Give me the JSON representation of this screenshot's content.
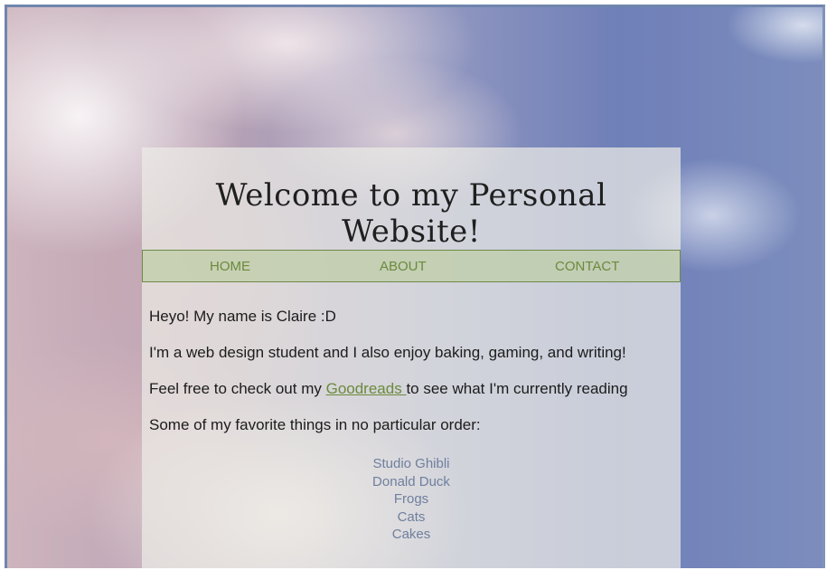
{
  "header": {
    "title": "Welcome to my Personal Website!"
  },
  "nav": {
    "items": [
      {
        "label": "HOME"
      },
      {
        "label": "ABOUT"
      },
      {
        "label": "CONTACT"
      }
    ]
  },
  "main": {
    "intro": "Heyo! My name is Claire :D",
    "about": "I'm a web design student and I also enjoy baking, gaming, and writing!",
    "goodreads_before": "Feel free to check out my ",
    "goodreads_link": "Goodreads ",
    "goodreads_after": "to see what I'm currently reading",
    "favorites_heading": "Some of my favorite things in no particular order:",
    "favorites": [
      "Studio Ghibli",
      "Donald Duck",
      "Frogs",
      "Cats",
      "Cakes"
    ]
  },
  "colors": {
    "accent_green": "#6b8a3c",
    "list_blue": "#6f7f9e",
    "nav_bg": "#becda5"
  }
}
